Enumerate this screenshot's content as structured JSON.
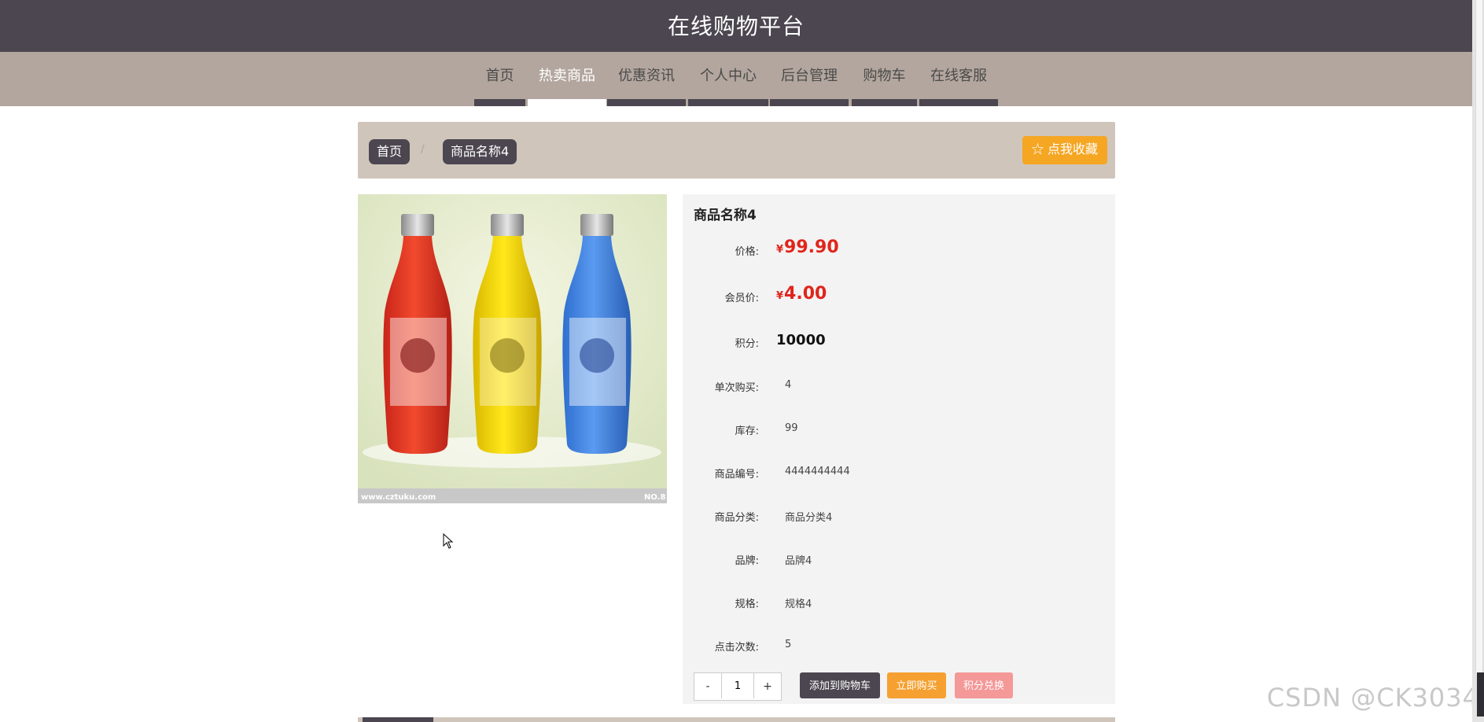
{
  "site": {
    "title": "在线购物平台"
  },
  "nav": {
    "items": [
      {
        "label": "首页"
      },
      {
        "label": "热卖商品"
      },
      {
        "label": "优惠资讯"
      },
      {
        "label": "个人中心"
      },
      {
        "label": "后台管理"
      },
      {
        "label": "购物车"
      },
      {
        "label": "在线客服"
      }
    ],
    "active": "热卖商品"
  },
  "breadcrumb": {
    "home": "首页",
    "separator": "/",
    "current": "商品名称4"
  },
  "favorite": {
    "label": "点我收藏",
    "icon": "star-outline-icon"
  },
  "product": {
    "name": "商品名称4",
    "currency": "¥",
    "price": "99.90",
    "member_price": "4.00",
    "points": "10000",
    "image_footer_left": "www.cztuku.com",
    "image_footer_right": "NO.8",
    "labels": {
      "price": "价格:",
      "member_price": "会员价:",
      "points": "积分:",
      "single_purchase": "单次购买:",
      "stock": "库存:",
      "code": "商品编号:",
      "category": "商品分类:",
      "brand": "品牌:",
      "spec": "规格:",
      "clicks": "点击次数:"
    },
    "single_purchase": "4",
    "stock": "99",
    "code": "4444444444",
    "category": "商品分类4",
    "brand": "品牌4",
    "spec": "规格4",
    "clicks": "5"
  },
  "quantity": {
    "minus": "-",
    "value": "1",
    "plus": "+"
  },
  "actions": {
    "add_to_cart": "添加到购物车",
    "buy_now": "立即购买",
    "redeem_points": "积分兑换"
  },
  "colors": {
    "header": "#4b4650",
    "nav": "#b3a69e",
    "breadcrumb_bg": "#d0c5bb",
    "price_red": "#e0251b",
    "favorite_orange": "#f5a623",
    "buy_orange": "#f5a030",
    "redeem_pink": "#f59898"
  },
  "watermark": "CSDN @CK3034"
}
